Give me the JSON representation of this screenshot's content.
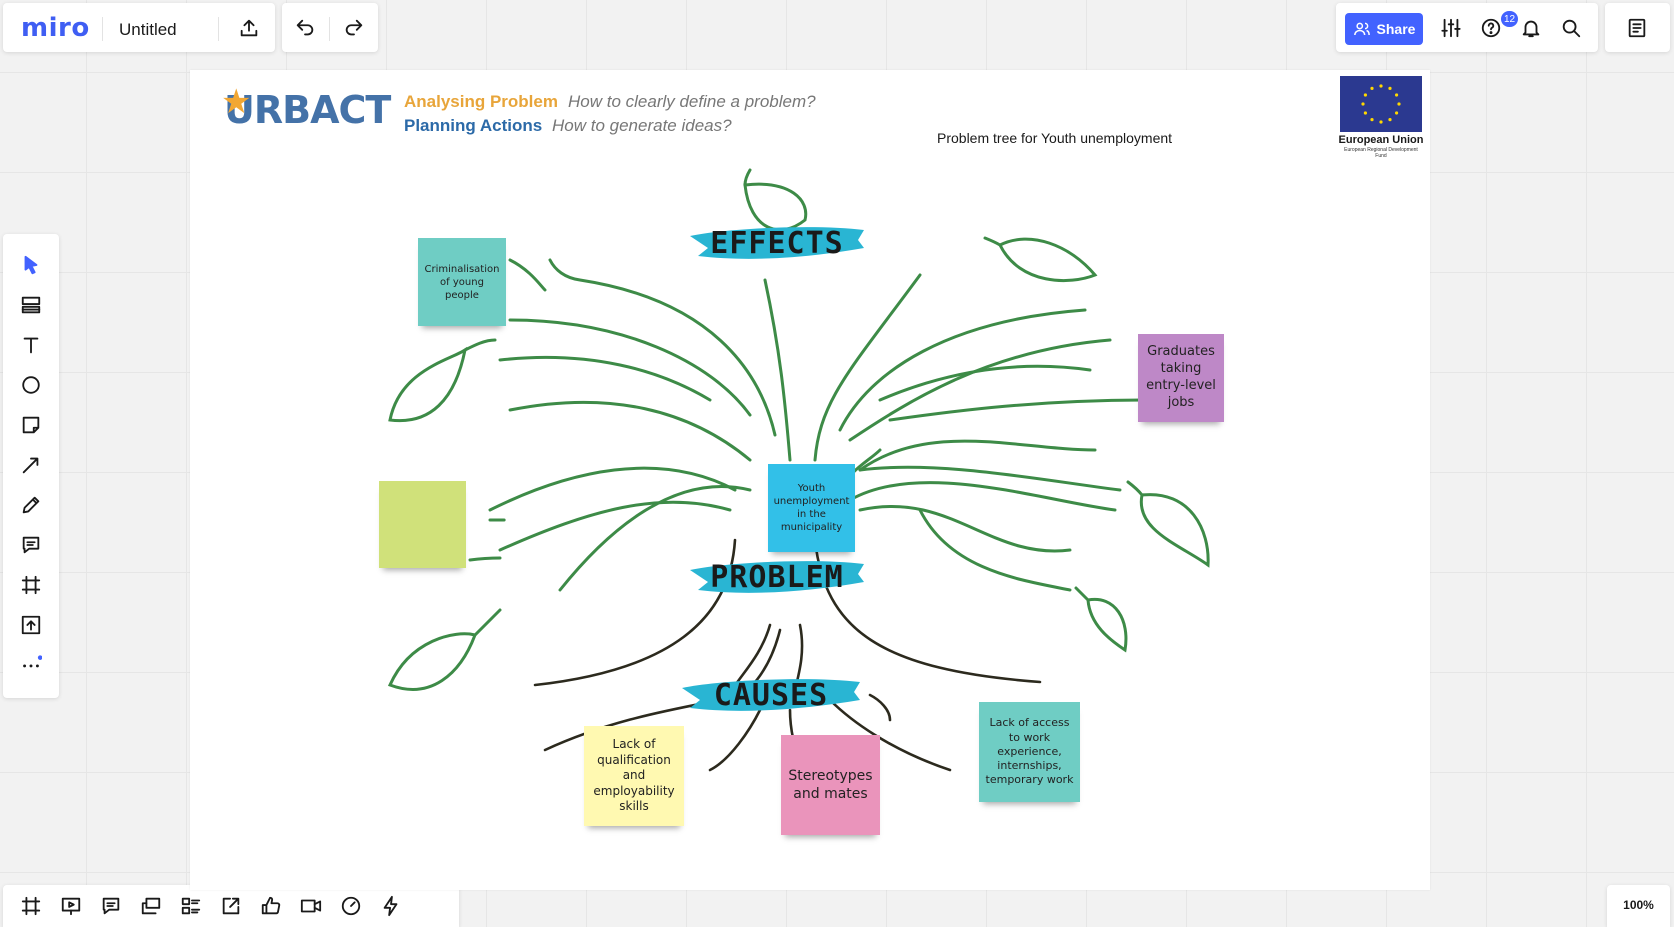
{
  "toolbar": {
    "logo": "miro",
    "board_title": "Untitled",
    "share_label": "Share",
    "notifications_count": "12"
  },
  "zoom": {
    "label": "100%"
  },
  "frame": {
    "urbact_logo": "URBACT",
    "heading1_label": "Analysing Problem",
    "heading1_question": "How to clearly define a problem?",
    "heading2_label": "Planning Actions",
    "heading2_question": "How to generate ideas?",
    "tree_title": "Problem tree for Youth unemployment",
    "eu_label": "European Union",
    "eu_sub": "European Regional Development Fund"
  },
  "banners": {
    "effects": "EFFECTS",
    "problem": "PROBLEM",
    "causes": "CAUSES"
  },
  "stickies": {
    "criminalisation": "Criminalisation of young people",
    "graduates": "Graduates taking entry-level jobs",
    "empty_green": "",
    "youth_unemployment": "Youth unemployment in the municipality",
    "lack_qualification": "Lack of qualification and employability skills",
    "stereotypes": "Stereotypes and mates",
    "lack_access": "Lack of access to work experience, internships, temporary work"
  },
  "colors": {
    "accent": "#4262ff",
    "sticky_teal": "#6fcdc4",
    "sticky_purple": "#be88c7",
    "sticky_green": "#d0e17a",
    "sticky_cyan": "#32c0e8",
    "sticky_yellow": "#fff9b1",
    "sticky_pink": "#ea94bb",
    "branch_green": "#3d8b47",
    "root_dark": "#2c2a1e",
    "banner_cyan": "#29b5d3"
  },
  "icons": {
    "top": [
      "upload-icon",
      "undo-icon",
      "redo-icon",
      "settings-sliders-icon",
      "help-icon",
      "bell-icon",
      "search-icon",
      "notes-icon"
    ],
    "left_tools": [
      "select-arrow-icon",
      "templates-icon",
      "text-icon",
      "shape-icon",
      "sticky-note-icon",
      "connection-line-icon",
      "pen-icon",
      "comment-icon",
      "frame-icon",
      "upload-icon",
      "more-icon"
    ],
    "bottom_tools": [
      "frames-icon",
      "presentation-icon",
      "comments-icon",
      "screen-sharing-icon",
      "card-icon",
      "export-icon",
      "voting-icon",
      "video-call-icon",
      "timer-icon",
      "power-up-icon"
    ]
  }
}
